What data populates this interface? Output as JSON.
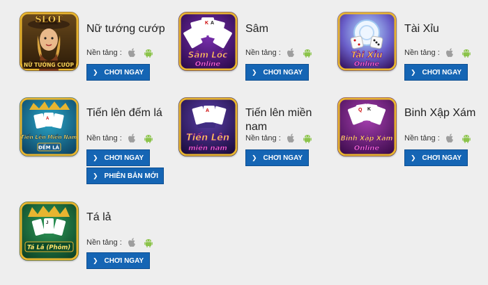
{
  "platform_label": "Nền tảng :",
  "platform_icons": [
    "apple-icon",
    "android-icon"
  ],
  "colors": {
    "button": "#1565b4",
    "android": "#8bc34a",
    "apple": "#9e9e9e",
    "background": "#eeeeee"
  },
  "games": [
    {
      "title": "Nữ tướng cướp",
      "thumb_text": [
        "SLOT",
        "NỮ TƯỚNG CƯỚP"
      ],
      "play_label": "CHƠI NGAY"
    },
    {
      "title": "Sâm",
      "thumb_text": [
        "Sâm Lốc",
        "Online"
      ],
      "play_label": "CHƠI NGAY"
    },
    {
      "title": "Tài Xỉu",
      "thumb_text": [
        "Tài Xỉu",
        "Online"
      ],
      "play_label": "CHƠI NGAY"
    },
    {
      "title": "Tiến lên đếm lá",
      "thumb_text": [
        "Tiến Lên Miền Nam",
        "ĐẾM LÁ"
      ],
      "play_label": "CHƠI NGAY",
      "extra_label": "PHIÊN BẢN MỚI"
    },
    {
      "title": "Tiến lên miền nam",
      "thumb_text": [
        "Tiến Lên",
        "miền nam"
      ],
      "play_label": "CHƠI NGAY"
    },
    {
      "title": "Binh Xập Xám",
      "thumb_text": [
        "Binh Xập Xám",
        "Online"
      ],
      "play_label": "CHƠI NGAY"
    },
    {
      "title": "Tá lả",
      "thumb_text": [
        "Tá Lả (Phỏm)"
      ],
      "play_label": "CHƠI NGAY"
    }
  ]
}
